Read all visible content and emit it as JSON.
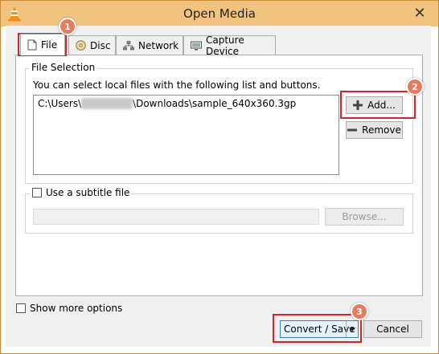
{
  "window": {
    "title": "Open Media",
    "close_glyph": "✕"
  },
  "tabs": [
    {
      "label": "File",
      "icon": "file-icon",
      "active": true
    },
    {
      "label": "Disc",
      "icon": "disc-icon",
      "active": false
    },
    {
      "label": "Network",
      "icon": "network-icon",
      "active": false
    },
    {
      "label": "Capture Device",
      "icon": "capture-device-icon",
      "active": false
    }
  ],
  "file_selection": {
    "legend": "File Selection",
    "instructions": "You can select local files with the following list and buttons.",
    "files": [
      {
        "prefix": "C:\\Users\\",
        "masked": "blurred",
        "suffix": "\\Downloads\\sample_640x360.3gp"
      }
    ],
    "add_label": "Add...",
    "remove_label": "Remove"
  },
  "subtitle": {
    "checkbox_label": "Use a subtitle file",
    "checked": false,
    "path_value": "",
    "browse_label": "Browse..."
  },
  "show_more_options": {
    "label": "Show more options",
    "checked": false
  },
  "footer": {
    "convert_label": "Convert / Save",
    "cancel_label": "Cancel"
  },
  "annotations": [
    {
      "number": "1",
      "target": "file-tab"
    },
    {
      "number": "2",
      "target": "add-button"
    },
    {
      "number": "3",
      "target": "convert-save-button"
    }
  ],
  "colors": {
    "titlebar": "#f2c37e",
    "highlight": "#d9232a",
    "badge": "#e87a5e",
    "vlc_orange": "#f28c1a"
  }
}
